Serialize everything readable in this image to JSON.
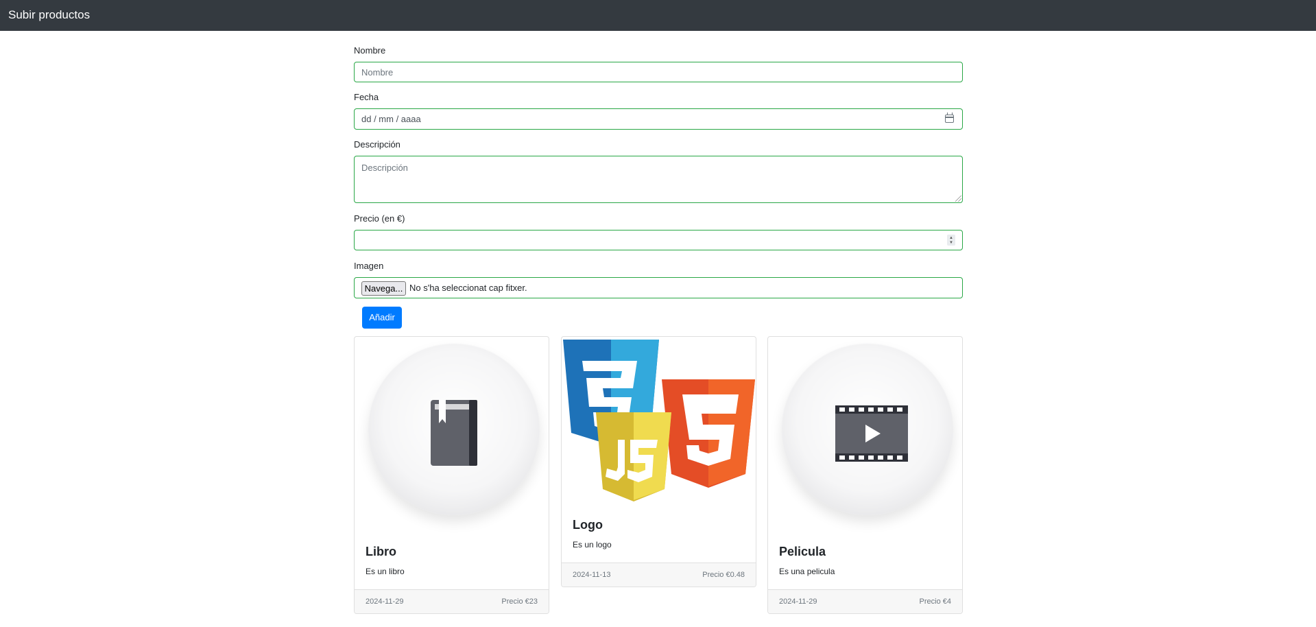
{
  "navbar": {
    "title": "Subir productos"
  },
  "form": {
    "name_label": "Nombre",
    "name_placeholder": "Nombre",
    "date_label": "Fecha",
    "date_placeholder": "dd / mm / aaaa",
    "description_label": "Descripción",
    "description_placeholder": "Descripción",
    "price_label": "Precio (en €)",
    "image_label": "Imagen",
    "file_button": "Navega...",
    "file_status": "No s'ha seleccionat cap fitxer.",
    "submit_label": "Añadir",
    "border_color": "#28a745"
  },
  "cards": [
    {
      "title": "Libro",
      "text": "Es un libro",
      "date": "2024-11-29",
      "price": "Precio €23",
      "icon": "book-icon"
    },
    {
      "title": "Logo",
      "text": "Es un logo",
      "date": "2024-11-13",
      "price": "Precio €0.48",
      "icon": "css-js-html5-logo"
    },
    {
      "title": "Pelicula",
      "text": "Es una pelicula",
      "date": "2024-11-29",
      "price": "Precio €4",
      "icon": "film-icon"
    }
  ]
}
